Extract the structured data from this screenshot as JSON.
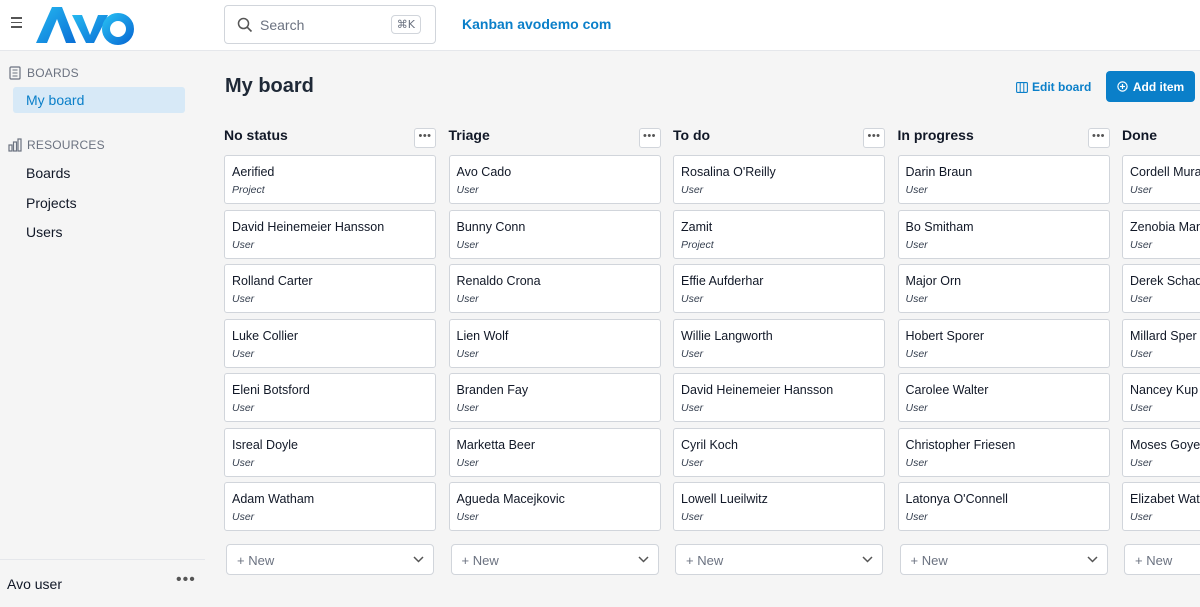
{
  "topbar": {
    "search_placeholder": "Search",
    "search_shortcut": "⌘K",
    "app_title": "Kanban avodemo com"
  },
  "sidebar": {
    "boards_header": "BOARDS",
    "boards": [
      {
        "label": "My board",
        "active": true
      }
    ],
    "resources_header": "RESOURCES",
    "resources": [
      {
        "label": "Boards"
      },
      {
        "label": "Projects"
      },
      {
        "label": "Users"
      }
    ],
    "user": "Avo user"
  },
  "main": {
    "title": "My board",
    "edit_board": "Edit board",
    "add_item": "Add item",
    "new_label": "+ New",
    "columns": [
      {
        "title": "No status",
        "cards": [
          {
            "name": "Aerified",
            "type": "Project"
          },
          {
            "name": "David Heinemeier Hansson",
            "type": "User"
          },
          {
            "name": "Rolland Carter",
            "type": "User"
          },
          {
            "name": "Luke Collier",
            "type": "User"
          },
          {
            "name": "Eleni Botsford",
            "type": "User"
          },
          {
            "name": "Isreal Doyle",
            "type": "User"
          },
          {
            "name": "Adam Watham",
            "type": "User"
          }
        ]
      },
      {
        "title": "Triage",
        "cards": [
          {
            "name": "Avo Cado",
            "type": "User"
          },
          {
            "name": "Bunny Conn",
            "type": "User"
          },
          {
            "name": "Renaldo Crona",
            "type": "User"
          },
          {
            "name": "Lien Wolf",
            "type": "User"
          },
          {
            "name": "Branden Fay",
            "type": "User"
          },
          {
            "name": "Marketta Beer",
            "type": "User"
          },
          {
            "name": "Agueda Macejkovic",
            "type": "User"
          }
        ]
      },
      {
        "title": "To do",
        "cards": [
          {
            "name": "Rosalina O'Reilly",
            "type": "User"
          },
          {
            "name": "Zamit",
            "type": "Project"
          },
          {
            "name": "Effie Aufderhar",
            "type": "User"
          },
          {
            "name": "Willie Langworth",
            "type": "User"
          },
          {
            "name": "David Heinemeier Hansson",
            "type": "User"
          },
          {
            "name": "Cyril Koch",
            "type": "User"
          },
          {
            "name": "Lowell Lueilwitz",
            "type": "User"
          }
        ]
      },
      {
        "title": "In progress",
        "cards": [
          {
            "name": "Darin Braun",
            "type": "User"
          },
          {
            "name": "Bo Smitham",
            "type": "User"
          },
          {
            "name": "Major Orn",
            "type": "User"
          },
          {
            "name": "Hobert Sporer",
            "type": "User"
          },
          {
            "name": "Carolee Walter",
            "type": "User"
          },
          {
            "name": "Christopher Friesen",
            "type": "User"
          },
          {
            "name": "Latonya O'Connell",
            "type": "User"
          }
        ]
      },
      {
        "title": "Done",
        "cards": [
          {
            "name": "Cordell Mura",
            "type": "User"
          },
          {
            "name": "Zenobia Man",
            "type": "User"
          },
          {
            "name": "Derek Schad",
            "type": "User"
          },
          {
            "name": "Millard Sper",
            "type": "User"
          },
          {
            "name": "Nancey Kup",
            "type": "User"
          },
          {
            "name": "Moses Goye",
            "type": "User"
          },
          {
            "name": "Elizabet Wat",
            "type": "User"
          }
        ]
      }
    ]
  },
  "colors": {
    "accent": "#0a7fc9",
    "active_bg": "#d7e9f7"
  }
}
